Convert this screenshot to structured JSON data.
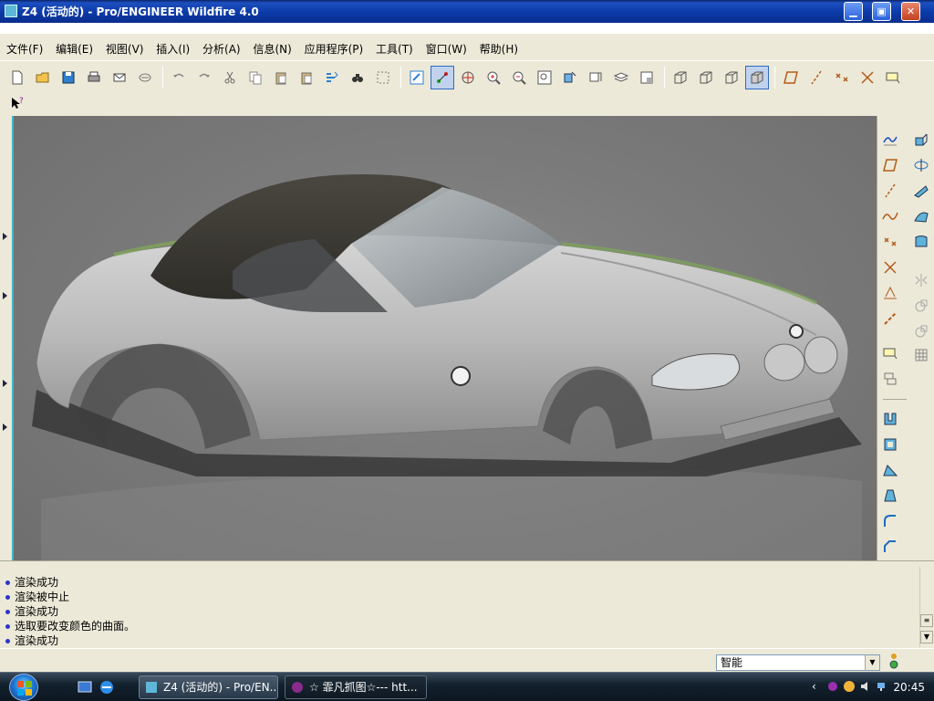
{
  "window": {
    "title": "Z4 (活动的) - Pro/ENGINEER Wildfire 4.0",
    "minimize": "▁",
    "maximize": "▣",
    "close": "✕"
  },
  "menu": {
    "items": [
      {
        "label": "文件(F)"
      },
      {
        "label": "编辑(E)"
      },
      {
        "label": "视图(V)"
      },
      {
        "label": "插入(I)"
      },
      {
        "label": "分析(A)"
      },
      {
        "label": "信息(N)"
      },
      {
        "label": "应用程序(P)"
      },
      {
        "label": "工具(T)"
      },
      {
        "label": "窗口(W)"
      },
      {
        "label": "帮助(H)"
      }
    ]
  },
  "toolbar": {
    "row1": [
      "new-file-icon",
      "open-folder-icon",
      "save-icon",
      "print-icon",
      "email-icon",
      "email-link-icon",
      "sep",
      "undo-icon",
      "redo-icon",
      "cut-icon",
      "copy-icon",
      "paste-icon",
      "paste-special-icon",
      "regenerate-icon",
      "find-icon",
      "select-box-icon",
      "sep",
      "repaint-icon",
      "spin-center-icon",
      "orient-icon",
      "zoom-in-icon",
      "zoom-out-icon",
      "refit-icon",
      "reorient-icon",
      "saved-views-icon",
      "layers-icon",
      "view-manager-icon",
      "sep",
      "wireframe-icon",
      "hidden-line-icon",
      "no-hidden-icon",
      "shading-icon",
      "sep",
      "datum-plane-icon",
      "datum-axis-icon",
      "datum-point-icon",
      "coord-sys-icon",
      "annotation-icon"
    ],
    "row2": [
      "whats-this-icon"
    ]
  },
  "messages": [
    "渲染成功",
    "渲染被中止",
    "渲染成功",
    "选取要改变颜色的曲面。",
    "渲染成功"
  ],
  "statusbar": {
    "filter_value": "智能"
  },
  "taskbar": {
    "tasks": [
      {
        "label": "Z4 (活动的) - Pro/EN...",
        "active": false
      },
      {
        "label": "☆ 霏凡抓图☆--- htt...",
        "active": true
      }
    ],
    "clock": "20:45"
  },
  "colors": {
    "accent": "#0b3aa8",
    "viewport_bg": "#7b7b7b",
    "message_bullet": "#2b36c9"
  }
}
